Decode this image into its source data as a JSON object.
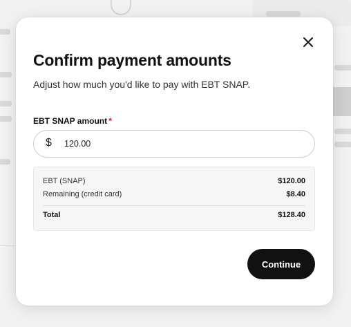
{
  "modal": {
    "title": "Confirm payment amounts",
    "subtitle": "Adjust how much you'd like to pay with EBT SNAP.",
    "close_icon": "close-icon"
  },
  "snap_field": {
    "label": "EBT SNAP amount",
    "required_marker": "*",
    "currency_symbol": "$",
    "value": "120.00"
  },
  "summary": {
    "rows": [
      {
        "label": "EBT (SNAP)",
        "value": "$120.00"
      },
      {
        "label": "Remaining (credit card)",
        "value": "$8.40"
      }
    ],
    "total": {
      "label": "Total",
      "value": "$128.40"
    }
  },
  "actions": {
    "continue_label": "Continue"
  },
  "colors": {
    "primary_button": "#111111",
    "required": "#e0182d",
    "summary_bg": "#f6f6f6"
  }
}
